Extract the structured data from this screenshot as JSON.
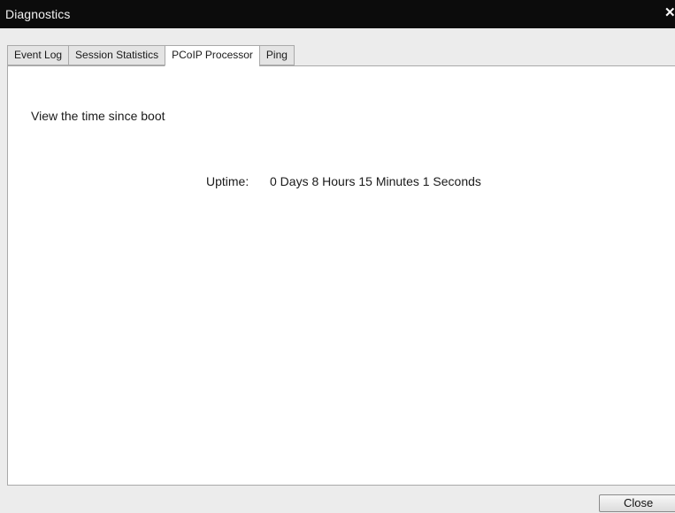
{
  "window": {
    "title": "Diagnostics",
    "close_glyph": "✕"
  },
  "tabs": [
    {
      "label": "Event Log",
      "active": false
    },
    {
      "label": "Session Statistics",
      "active": false
    },
    {
      "label": "PCoIP Processor",
      "active": true
    },
    {
      "label": "Ping",
      "active": false
    }
  ],
  "panel": {
    "description": "View the time since boot",
    "uptime_label": "Uptime:",
    "uptime_value": "0 Days 8 Hours 15 Minutes 1 Seconds"
  },
  "footer": {
    "close_label": "Close"
  },
  "colors": {
    "titlebar": "#0c0c0c",
    "panel": "#ffffff",
    "background": "#ececec",
    "border": "#a9a9a9"
  }
}
